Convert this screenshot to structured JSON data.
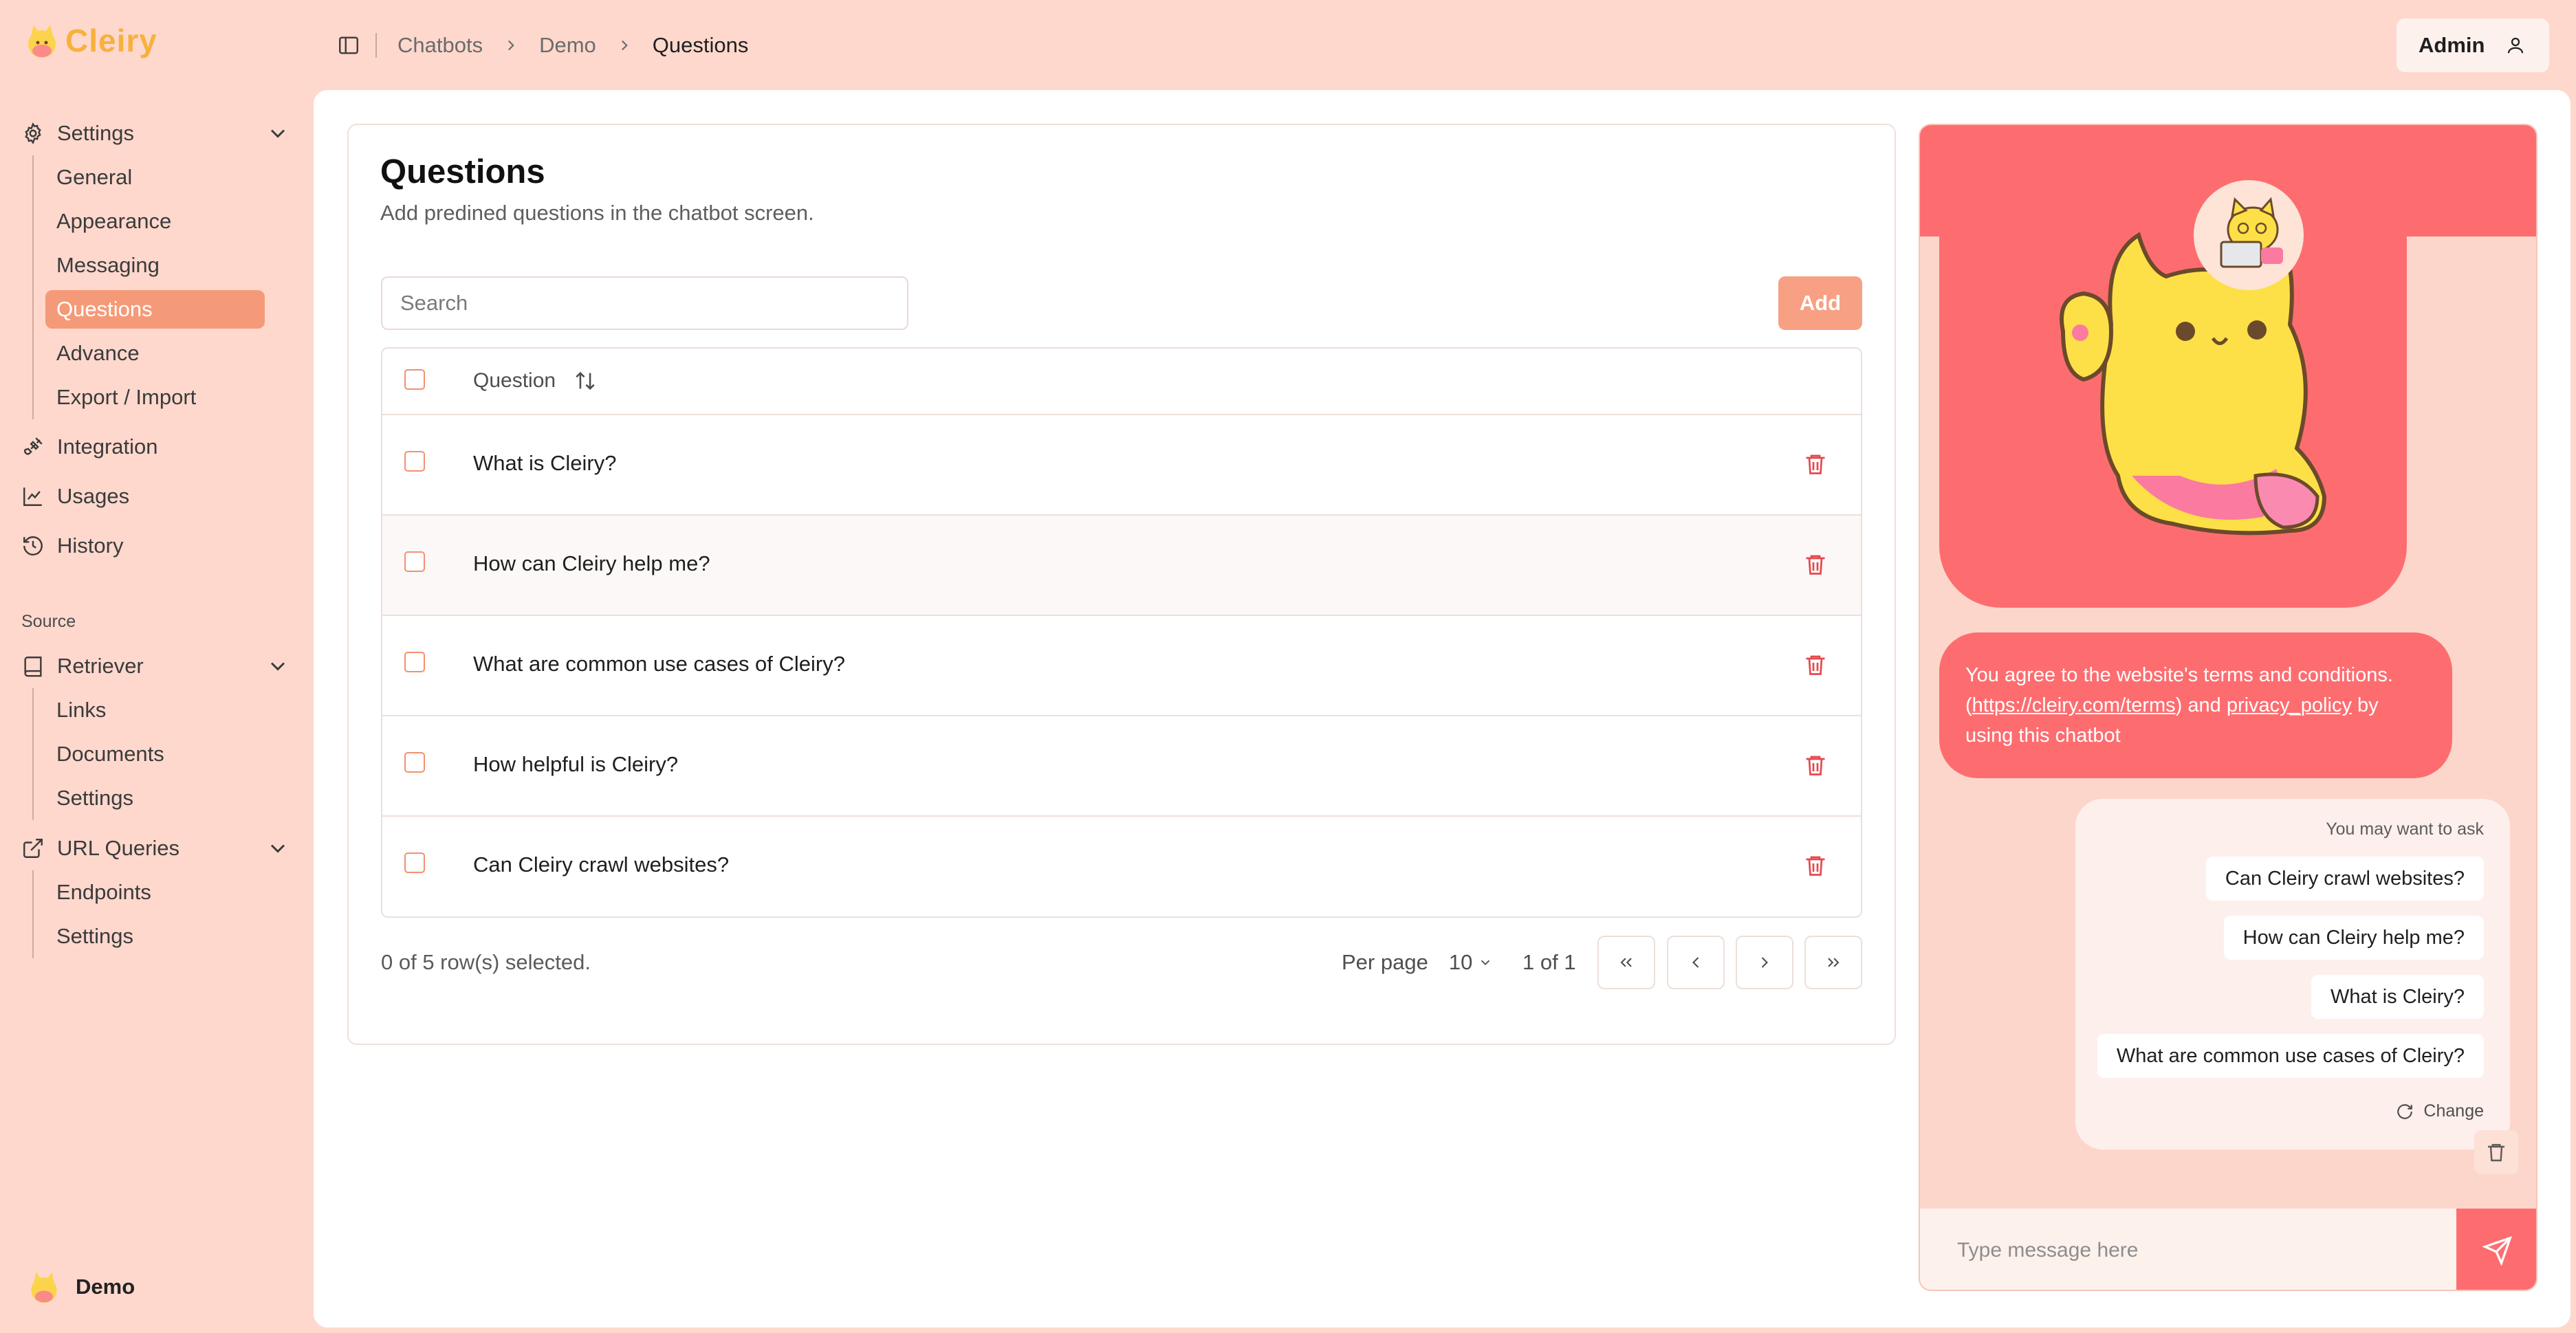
{
  "app": {
    "name": "Cleiry"
  },
  "sidebar": {
    "settings": {
      "label": "Settings",
      "items": [
        {
          "label": "General"
        },
        {
          "label": "Appearance"
        },
        {
          "label": "Messaging"
        },
        {
          "label": "Questions",
          "active": true
        },
        {
          "label": "Advance"
        },
        {
          "label": "Export / Import"
        }
      ]
    },
    "integration": {
      "label": "Integration"
    },
    "usages": {
      "label": "Usages"
    },
    "history": {
      "label": "History"
    },
    "source_label": "Source",
    "retriever": {
      "label": "Retriever",
      "items": [
        {
          "label": "Links"
        },
        {
          "label": "Documents"
        },
        {
          "label": "Settings"
        }
      ]
    },
    "url_queries": {
      "label": "URL Queries",
      "items": [
        {
          "label": "Endpoints"
        },
        {
          "label": "Settings"
        }
      ]
    },
    "user": {
      "name": "Demo"
    }
  },
  "topbar": {
    "breadcrumb": [
      "Chatbots",
      "Demo",
      "Questions"
    ],
    "admin_label": "Admin"
  },
  "page": {
    "title": "Questions",
    "subtitle": "Add predined questions in the chatbot screen.",
    "search_placeholder": "Search",
    "add_label": "Add",
    "table": {
      "header": "Question",
      "rows": [
        "What is Cleiry?",
        "How can Cleiry help me?",
        "What are common use cases of Cleiry?",
        "How helpful is Cleiry?",
        "Can Cleiry crawl websites?"
      ]
    },
    "footer": {
      "selected": "0 of 5 row(s) selected.",
      "per_page_label": "Per page",
      "per_page_value": "10",
      "page_of": "1 of 1"
    }
  },
  "chat": {
    "terms_prefix": "You agree to the website's terms and conditions. (",
    "terms_link": "https://cleiry.com/terms",
    "terms_mid": ") and ",
    "privacy_link": "privacy_policy",
    "terms_suffix": " by using this chatbot",
    "suggest_title": "You may want to ask",
    "suggestions": [
      "Can Cleiry crawl websites?",
      "How can Cleiry help me?",
      "What is Cleiry?",
      "What are common use cases of Cleiry?"
    ],
    "change_label": "Change",
    "input_placeholder": "Type message here"
  },
  "colors": {
    "background": "#fed8cd",
    "accent": "#f59a78",
    "chat_primary": "#fd6d70",
    "danger": "#e5484d",
    "logo": "#f7b13c"
  }
}
